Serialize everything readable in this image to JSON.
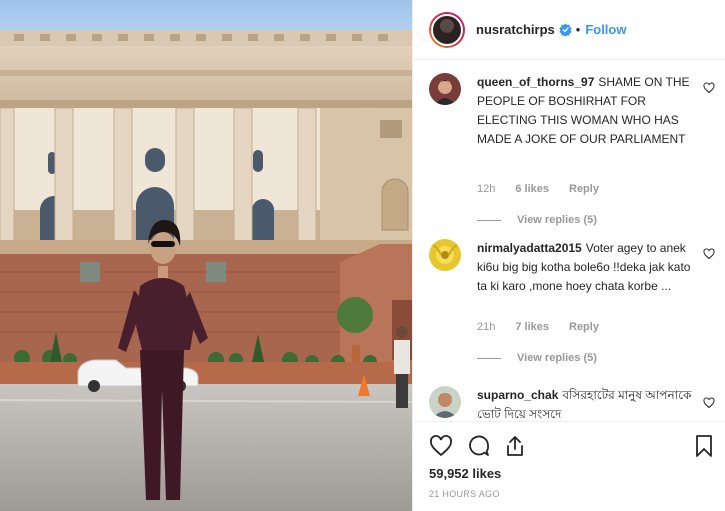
{
  "post": {
    "photo_alt": "",
    "likes_text": "59,952 likes",
    "timestamp": "21 HOURS AGO"
  },
  "header": {
    "username": "nusratchirps",
    "separator": "•",
    "follow_label": "Follow"
  },
  "comments": [
    {
      "username": "queen_of_thorns_97",
      "text": "SHAME ON THE PEOPLE OF BOSHIRHAT FOR ELECTING THIS WOMAN WHO HAS MADE A JOKE OF OUR PARLIAMENT",
      "time": "12h",
      "likes": "6 likes",
      "reply_label": "Reply",
      "view_replies": "View replies (5)"
    },
    {
      "username": "nirmalyadatta2015",
      "text": "Voter agey to anek ki6u big big kotha bole6o !!deka jak kato ta ki karo ,mone hoey chata korbe ...",
      "time": "21h",
      "likes": "7 likes",
      "reply_label": "Reply",
      "view_replies": "View replies (5)"
    },
    {
      "username": "suparno_chak",
      "text": "বসিরহাটের মানুষ আপনাকে ভোট দিয়ে সংসদে"
    }
  ],
  "icons": {
    "like": "heart-outline-icon",
    "comment": "speech-bubble-icon",
    "share": "share-icon",
    "save": "bookmark-icon",
    "verified": "verified-badge-icon",
    "comment_like": "small-heart-icon"
  },
  "colors": {
    "accent": "#3897f0",
    "text": "#262626",
    "muted": "#999999",
    "verified": "#3897f0"
  }
}
